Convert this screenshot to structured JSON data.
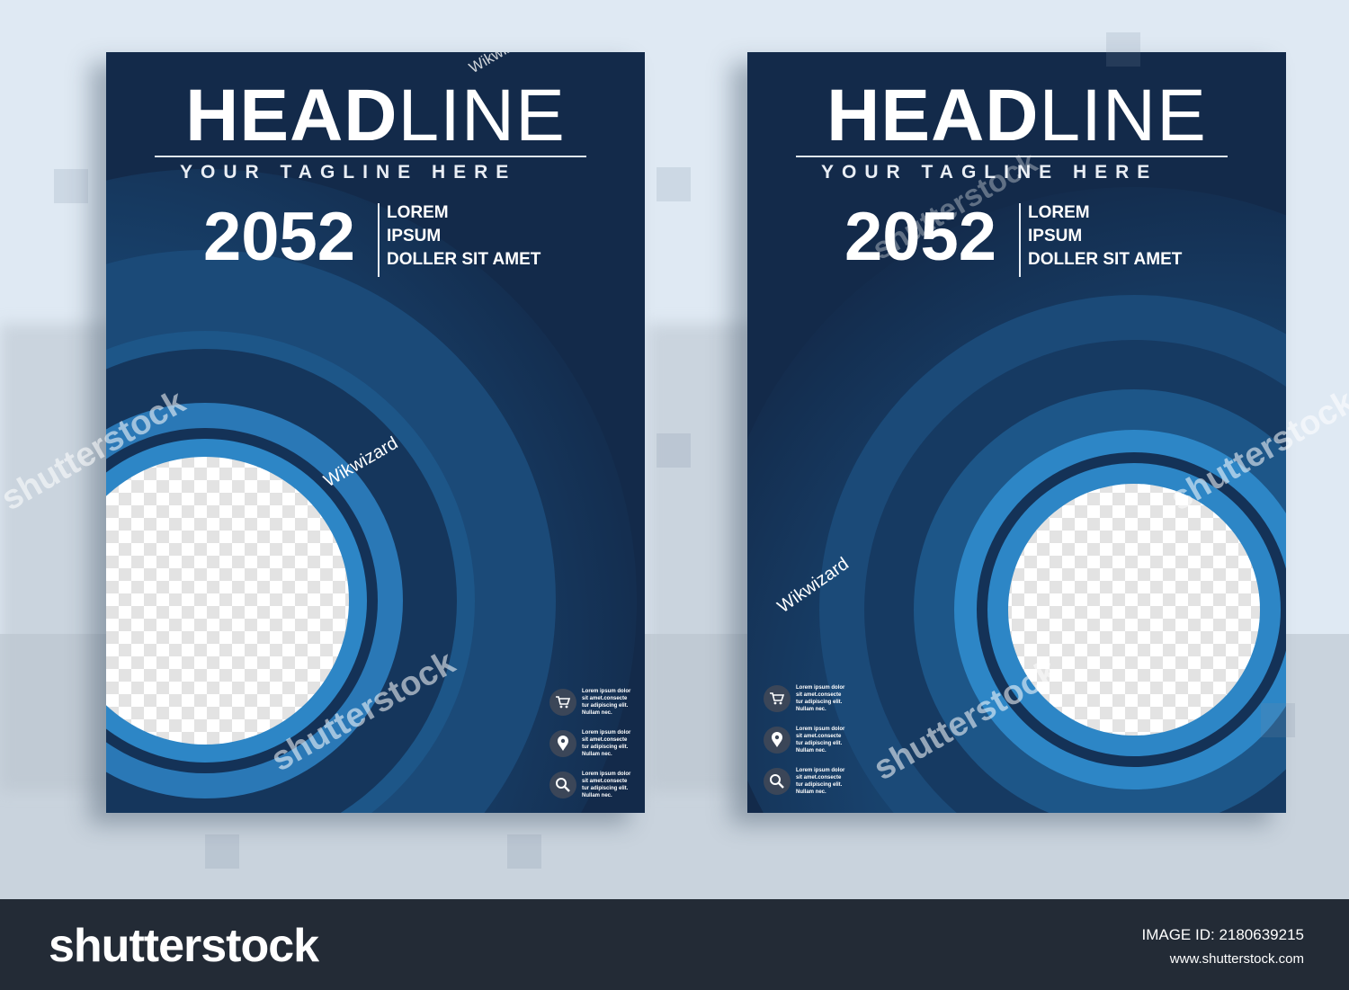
{
  "flyers": [
    {
      "headline_bold": "HEAD",
      "headline_thin": "LINE",
      "tagline": "YOUR TAGLINE HERE",
      "year": "2052",
      "lines": [
        "LOREM",
        "IPSUM",
        "DOLLER SIT AMET"
      ],
      "contacts": [
        {
          "icon": "cart-icon",
          "text": "Lorem ipsum dolor\nsit amet.consecte\ntur adipiscing elit.\nNullam nec."
        },
        {
          "icon": "location-pin-icon",
          "text": "Lorem ipsum dolor\nsit amet.consecte\ntur adipiscing elit.\nNullam nec."
        },
        {
          "icon": "search-icon",
          "text": "Lorem ipsum dolor\nsit amet.consecte\ntur adipiscing elit.\nNullam nec."
        }
      ]
    },
    {
      "headline_bold": "HEAD",
      "headline_thin": "LINE",
      "tagline": "YOUR TAGLINE HERE",
      "year": "2052",
      "lines": [
        "LOREM",
        "IPSUM",
        "DOLLER SIT AMET"
      ],
      "contacts": [
        {
          "icon": "cart-icon",
          "text": "Lorem ipsum dolor\nsit amet.consecte\ntur adipiscing elit.\nNullam nec."
        },
        {
          "icon": "location-pin-icon",
          "text": "Lorem ipsum dolor\nsit amet.consecte\ntur adipiscing elit.\nNullam nec."
        },
        {
          "icon": "search-icon",
          "text": "Lorem ipsum dolor\nsit amet.consecte\ntur adipiscing elit.\nNullam nec."
        }
      ]
    }
  ],
  "watermarks": {
    "author": "Wikwizard",
    "stock": "shutterstock"
  },
  "footer": {
    "logo": "shutterstock",
    "image_id": "IMAGE ID: 2180639215",
    "url": "www.shutterstock.com"
  },
  "colors": {
    "navy": "#132a4a",
    "ring": "#1d4f7e",
    "accent": "#2f86c4",
    "footer": "#232b36"
  }
}
